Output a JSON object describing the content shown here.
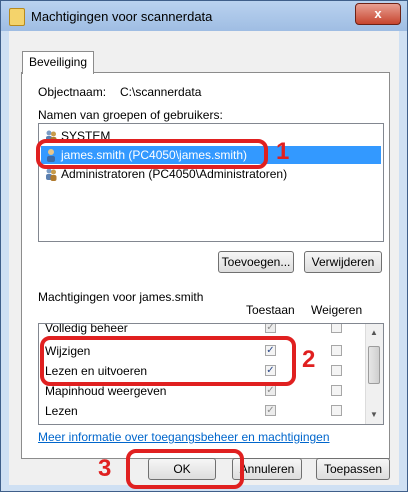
{
  "window": {
    "title": "Machtigingen voor scannerdata",
    "close_label": "x"
  },
  "tab": {
    "label": "Beveiliging"
  },
  "object": {
    "label": "Objectnaam:",
    "value": "C:\\scannerdata"
  },
  "groups": {
    "label": "Namen van groepen of gebruikers:",
    "items": [
      {
        "label": "SYSTEM",
        "icon": "users-icon"
      },
      {
        "label": "james.smith (PC4050\\james.smith)",
        "icon": "user-icon"
      },
      {
        "label": "Administratoren (PC4050\\Administratoren)",
        "icon": "users-icon"
      }
    ]
  },
  "buttons": {
    "add": "Toevoegen...",
    "remove": "Verwijderen",
    "ok": "OK",
    "cancel": "Annuleren",
    "apply": "Toepassen"
  },
  "permissions": {
    "label": "Machtigingen voor james.smith",
    "allow_header": "Toestaan",
    "deny_header": "Weigeren",
    "rows": [
      {
        "label": "Volledig beheer",
        "allow": true,
        "allow_grey": true,
        "deny": false
      },
      {
        "label": "Wijzigen",
        "allow": true,
        "allow_grey": false,
        "deny": false
      },
      {
        "label": "Lezen en uitvoeren",
        "allow": true,
        "allow_grey": false,
        "deny": false
      },
      {
        "label": "Mapinhoud weergeven",
        "allow": true,
        "allow_grey": true,
        "deny": false
      },
      {
        "label": "Lezen",
        "allow": true,
        "allow_grey": true,
        "deny": false
      }
    ]
  },
  "link": "Meer informatie over toegangsbeheer en machtigingen",
  "callouts": {
    "one": "1",
    "two": "2",
    "three": "3"
  },
  "colors": {
    "accent": "#e02020",
    "selection": "#3399ff",
    "link": "#0066cc"
  }
}
